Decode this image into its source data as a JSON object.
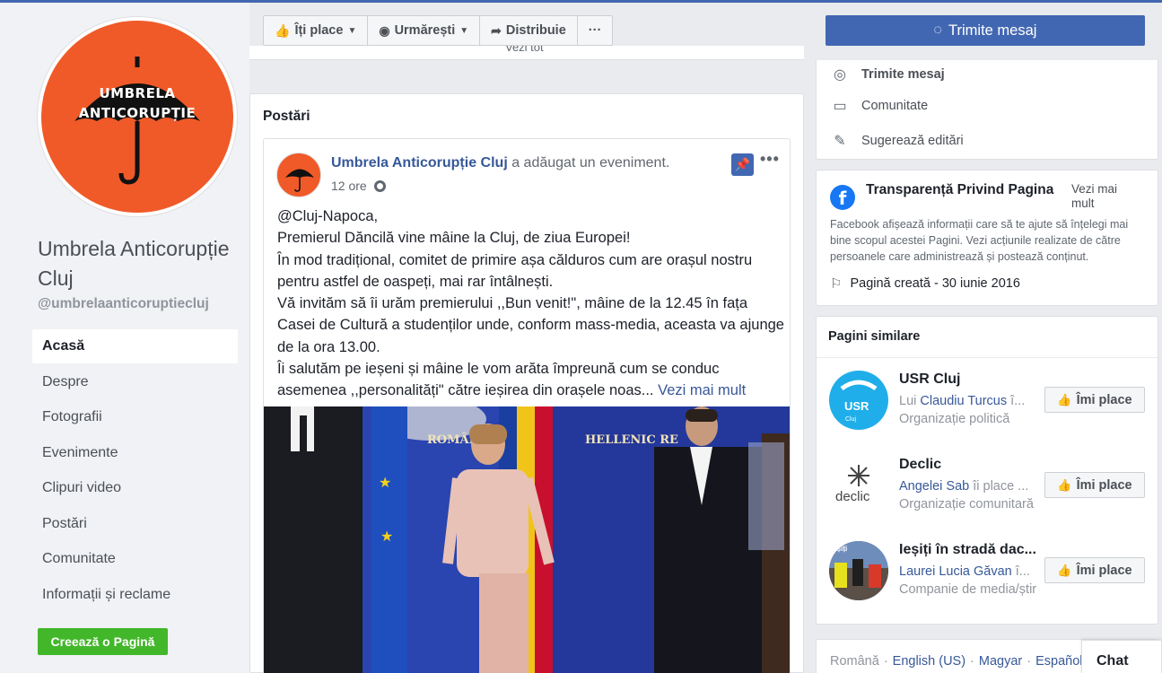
{
  "page": {
    "avatar_text_line1": "UMBRELA",
    "avatar_text_line2": "ANTICORUPȚIE",
    "name": "Umbrela Anticorupție Cluj",
    "handle": "@umbrelaanticoruptiecluj"
  },
  "nav": {
    "items": [
      {
        "label": "Acasă",
        "active": true
      },
      {
        "label": "Despre"
      },
      {
        "label": "Fotografii"
      },
      {
        "label": "Evenimente"
      },
      {
        "label": "Clipuri video"
      },
      {
        "label": "Postări"
      },
      {
        "label": "Comunitate"
      },
      {
        "label": "Informații și reclame"
      }
    ],
    "create_page": "Creează o Pagină"
  },
  "actions": {
    "like": "Îți place",
    "follow": "Urmărești",
    "share": "Distribuie",
    "more": "···",
    "send_message": "Trimite mesaj"
  },
  "center": {
    "see_all": "Vezi tot",
    "posts_title": "Postări",
    "post": {
      "author": "Umbrela Anticorupție Cluj",
      "action": " a adăugat un eveniment.",
      "time": "12 ore",
      "more": "•••",
      "lines": [
        "@Cluj-Napoca,",
        "Premierul Dăncilă vine mâine la Cluj, de ziua Europei!",
        "În mod tradițional, comitet de primire așa călduros cum are orașul nostru pentru astfel de oaspeți, mai rar întâlnești.",
        "Vă invităm să îi urăm premierului ,,Bun venit!\", mâine de la 12.45 în fața Casei de Cultură a studenților unde, conform mass-media, aceasta va ajunge de la ora 13.00.",
        "Îi salutăm pe ieșeni și mâine le vom arăta împreună cum se conduc asemenea ,,personalități\" către ieșirea din orașele noas..."
      ],
      "see_more": "Vezi mai mult",
      "photo_labels": {
        "left": "ROMÂNIA",
        "right": "HELLENIC RE"
      }
    }
  },
  "right": {
    "menu": [
      {
        "icon": "messenger-icon",
        "label": "Trimite mesaj"
      },
      {
        "icon": "notes-icon",
        "label": "Comunitate"
      },
      {
        "icon": "pencil-icon",
        "label": "Sugerează editări"
      }
    ],
    "transparency": {
      "title": "Transparență Privind Pagina",
      "see_more": "Vezi mai mult",
      "description": "Facebook afișează informații care să te ajute să înțelegi mai bine scopul acestei Pagini. Vezi acțiunile realizate de către persoanele care administrează și postează conținut.",
      "created": "Pagină creată - 30 iunie 2016"
    },
    "similar": {
      "title": "Pagini similare",
      "like_label": "Îmi place",
      "items": [
        {
          "name": "USR Cluj",
          "pre": "Lui ",
          "friend": "Claudiu Turcus",
          "post": " î...",
          "category": "Organizație politică"
        },
        {
          "name": "Declic",
          "pre": "",
          "friend": "Angelei Sab",
          "post": " îi place ...",
          "category": "Organizație comunitară"
        },
        {
          "name": "Ieșiți în stradă dac...",
          "pre": "",
          "friend": "Laurei Lucia Găvan",
          "post": " î...",
          "category": "Companie de media/știr"
        }
      ]
    },
    "languages": {
      "current": "Română",
      "others": [
        "English (US)",
        "Magyar",
        "Español"
      ]
    },
    "chat": "Chat"
  },
  "colors": {
    "brand_blue": "#4267b2",
    "orange": "#f05a28",
    "green": "#42b72a",
    "link": "#365899"
  }
}
